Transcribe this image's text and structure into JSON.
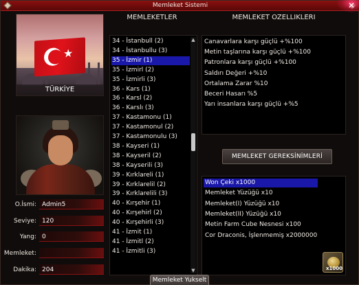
{
  "window": {
    "title": "Memleket Sistemi"
  },
  "left": {
    "country_label": "TÜRKİYE",
    "fields": [
      {
        "label": "O.İsmi:",
        "value": "Admin5"
      },
      {
        "label": "Seviye:",
        "value": "120"
      },
      {
        "label": "Yang:",
        "value": "0"
      },
      {
        "label": "Memleket:",
        "value": ""
      },
      {
        "label": "Dakika:",
        "value": "204"
      }
    ]
  },
  "cities": {
    "header": "MEMLEKETLER",
    "selected_index": 2,
    "items": [
      "34 - İstanbull (2)",
      "34 - İstanbullu (3)",
      "35 - İzmir (1)",
      "35 - İzmirl (2)",
      "35 - İzmirli (3)",
      "36 - Kars (1)",
      "36 - Karsl (2)",
      "36 - Karslı (3)",
      "37 - Kastamonu (1)",
      "37 - Kastamonul (2)",
      "37 - Kastamonulu (3)",
      "38 - Kayseri (1)",
      "38 - Kayseril (2)",
      "38 - Kayserili (3)",
      "39 - Kırklareli (1)",
      "39 - Kırklarelil (2)",
      "39 - Kırklarelili (3)",
      "40 - Kırşehir (1)",
      "40 - Kırşehirl (2)",
      "40 - Kırşehirli (3)",
      "41 - İzmit (1)",
      "41 - İzmitl (2)",
      "41 - İzmitli (3)"
    ]
  },
  "features": {
    "header": "MEMLEKET OZELLIKLERI",
    "items": [
      "Canavarlara karşı güçlü +%100",
      "Metin taşlarına karşı güçlü +%100",
      "Patronlara karşı güçlü +%100",
      "Saldırı Değeri +%10",
      "Ortalama Zarar %10",
      "Beceri Hasarı %5",
      "Yarı insanlara karşı güçlü +%5"
    ]
  },
  "requirements": {
    "header": "MEMLEKET GEREKSİNİMLERİ",
    "selected_index": 0,
    "items": [
      "Won Çeki x1000",
      "Memleket Yüzüğü x10",
      "Memleket(I) Yüzüğü x10",
      "Memleket(II) Yüzüğü x10",
      "Metin Farm Cube Nesnesi x100",
      "Cor Draconis, İşlenmemiş x2000000"
    ],
    "icon_name": "won-cheque-icon",
    "icon_qty": "x1000"
  },
  "footer": {
    "upgrade_label": "Memleket Yukselt"
  },
  "colors": {
    "title_bar": "#8a1010",
    "selection": "#1a18a8",
    "field_accent": "#8a1212"
  }
}
